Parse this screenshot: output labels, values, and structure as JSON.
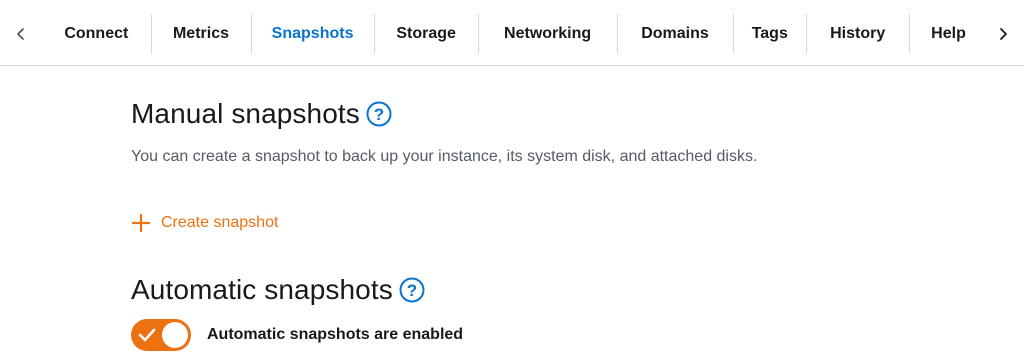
{
  "tabs": [
    {
      "label": "Connect"
    },
    {
      "label": "Metrics"
    },
    {
      "label": "Snapshots"
    },
    {
      "label": "Storage"
    },
    {
      "label": "Networking"
    },
    {
      "label": "Domains"
    },
    {
      "label": "Tags"
    },
    {
      "label": "History"
    },
    {
      "label": "Help"
    }
  ],
  "active_tab": "Snapshots",
  "manual": {
    "title": "Manual snapshots",
    "description": "You can create a snapshot to back up your instance, its system disk, and attached disks.",
    "create_label": "Create snapshot"
  },
  "automatic": {
    "title": "Automatic snapshots",
    "toggle_label": "Automatic snapshots are enabled",
    "enabled": true
  },
  "colors": {
    "accent": "#ec7211",
    "link_blue": "#0972d3",
    "text": "#16191f",
    "muted": "#545b64"
  },
  "icons": {
    "scroll_left": "chevron-left-icon",
    "scroll_right": "chevron-right-icon",
    "help": "help-circle-icon",
    "create": "plus-icon",
    "toggle": "check-icon"
  }
}
